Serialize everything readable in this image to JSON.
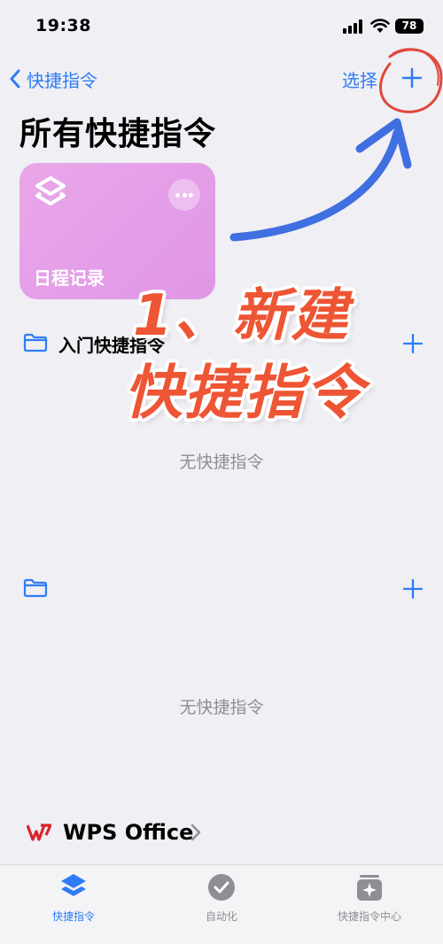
{
  "status_bar": {
    "time": "19:38",
    "battery": "78"
  },
  "nav": {
    "back_label": "快捷指令",
    "select_label": "选择"
  },
  "page_title": "所有快捷指令",
  "card": {
    "name": "日程记录",
    "color": "#e59fe8"
  },
  "sections": [
    {
      "label": "入门快捷指令",
      "empty_text": "无快捷指令"
    },
    {
      "label": "",
      "empty_text": "无快捷指令"
    }
  ],
  "wps": {
    "name": "WPS Office"
  },
  "tabbar": {
    "tabs": [
      {
        "label": "快捷指令",
        "active": true
      },
      {
        "label": "自动化",
        "active": false
      },
      {
        "label": "快捷指令中心",
        "active": false
      }
    ]
  },
  "annotation": {
    "line1": "1、新建",
    "line2": "快捷指令"
  },
  "colors": {
    "accent": "#2f7cf6",
    "annotation": "#ee5534",
    "arrow": "#3f6fe0"
  }
}
